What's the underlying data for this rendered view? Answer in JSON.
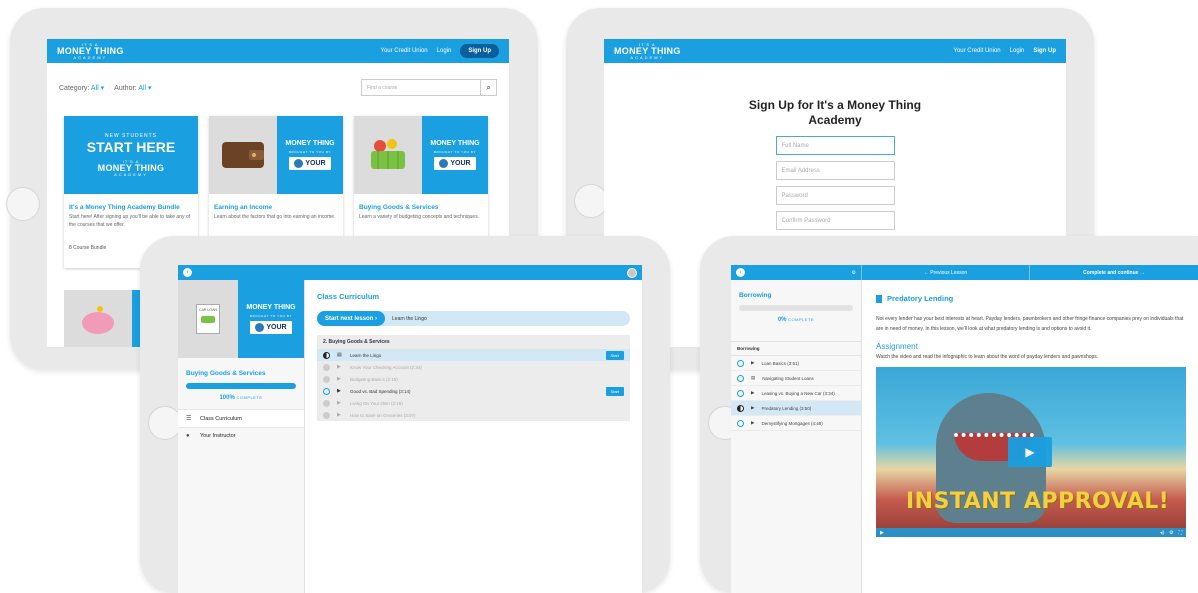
{
  "brand": {
    "logo_small": "IT'S A",
    "logo_big": "MONEY THING",
    "logo_sub": "ACADEMY",
    "brought": "BROUGHT TO YOU BY",
    "your": "YOUR",
    "accent": "#1a9fe0"
  },
  "catalog": {
    "header_links": [
      "Your Credit Union",
      "Login"
    ],
    "signup": "Sign Up",
    "category_label": "Category:",
    "category_value": "All ▾",
    "author_label": "Author:",
    "author_value": "All ▾",
    "search_placeholder": "Find a course",
    "search_icon": "search-icon",
    "start_small": "NEW STUDENTS",
    "start_big": "START HERE",
    "cards": [
      {
        "title": "It's a Money Thing Academy Bundle",
        "desc": "Start here! After signing up you'll be able to take any of the courses that we offer.",
        "footer": "8 Course Bundle"
      },
      {
        "title": "Earning an Income",
        "desc": "Learn about the factors that go into earning an income.",
        "footer": ""
      },
      {
        "title": "Buying Goods & Services",
        "desc": "Learn a variety of budgeting concepts and techniques.",
        "footer": ""
      }
    ]
  },
  "signup": {
    "header_links": [
      "Your Credit Union",
      "Login"
    ],
    "signup": "Sign Up",
    "title_line1": "Sign Up for It's a Money Thing",
    "title_line2": "Academy",
    "fields": [
      "Full Name",
      "Email Address",
      "Password",
      "Confirm Password"
    ]
  },
  "curriculum": {
    "car_loan": "CAR LOAN",
    "course_title": "Buying Goods & Services",
    "progress_pct": "100%",
    "progress_word": "COMPLETE",
    "progress_fraction": 1.0,
    "nav": [
      {
        "label": "Class Curriculum",
        "icon": "list-icon"
      },
      {
        "label": "Your Instructor",
        "icon": "person-icon"
      }
    ],
    "main_title": "Class Curriculum",
    "next_button": "Start next lesson ›",
    "next_lesson": "Learn the Lingo",
    "section": "2. Buying Goods & Services",
    "start_label": "Start",
    "lessons": [
      {
        "label": "Learn the Lingo",
        "state": "half",
        "type": "doc"
      },
      {
        "label": "Know Your Checking Account (2:34)",
        "state": "done",
        "type": "video"
      },
      {
        "label": "Budgeting Basics (2:16)",
        "state": "done",
        "type": "video"
      },
      {
        "label": "Good vs. Bad Spending (3:14)",
        "state": "open",
        "type": "video"
      },
      {
        "label": "Living On Your Own (2:16)",
        "state": "done",
        "type": "video"
      },
      {
        "label": "How to Save on Groceries (3:07)",
        "state": "done",
        "type": "video"
      }
    ]
  },
  "lesson": {
    "prev": "← Previous Lesson",
    "complete": "Complete and continue →",
    "course": "Borrowing",
    "progress_pct": "0%",
    "progress_word": "COMPLETE",
    "progress_fraction": 0.0,
    "group": "Borrowing",
    "items": [
      {
        "label": "Loan Basics (3:51)",
        "state": "open"
      },
      {
        "label": "Navigating Student Loans",
        "state": "open"
      },
      {
        "label": "Leasing vs. Buying a New Car (3:34)",
        "state": "open"
      },
      {
        "label": "Predatory Lending (3:50)",
        "state": "half"
      },
      {
        "label": "Demystifying Mortgages (4:48)",
        "state": "open"
      }
    ],
    "title": "Predatory Lending",
    "paragraph": "Not every lender has your best interests at heart. Payday lenders, pawnbrokers and other fringe finance companies prey on individuals that are in need of money. In this lesson, we'll look at what predatory lending is and options to avoid it.",
    "assignment_title": "Assignment",
    "assignment_text": "Watch the video and read the infographic to learn about the word of payday lenders and pawnshops.",
    "video_caption": "INSTANT APPROVAL!"
  }
}
